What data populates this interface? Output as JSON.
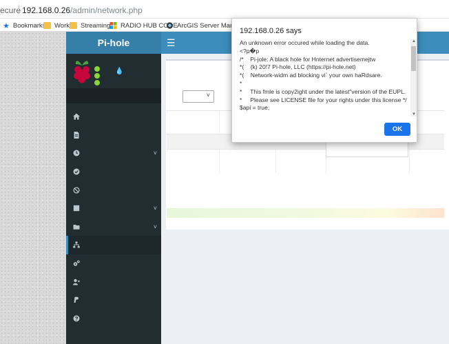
{
  "browser": {
    "secure_label": "ecure",
    "host": "192.168.0.26",
    "path": "/admin/network.php"
  },
  "bookmarks": [
    {
      "label": "Bookmarks",
      "icon": "star-icon"
    },
    {
      "label": "Work",
      "icon": "folder-icon"
    },
    {
      "label": "Streaming",
      "icon": "folder-icon"
    },
    {
      "label": "RADIO HUB CODE",
      "icon": "windows-logo-icon"
    },
    {
      "label": "ArcGIS Server Mana...",
      "icon": "arcgis-globe-icon"
    }
  ],
  "app": {
    "title": "Pi-hole",
    "menu_icon": "hamburger-icon"
  },
  "sidebar": {
    "items": [
      {
        "icon": "home-icon",
        "expandable": false
      },
      {
        "icon": "file-icon",
        "expandable": false
      },
      {
        "icon": "clock-icon",
        "expandable": true
      },
      {
        "icon": "check-circle-icon",
        "expandable": false
      },
      {
        "icon": "ban-icon",
        "expandable": false
      },
      {
        "icon": "square-icon",
        "expandable": true
      },
      {
        "icon": "folder-icon",
        "expandable": true
      },
      {
        "icon": "sitemap-icon",
        "expandable": false,
        "active": true
      },
      {
        "icon": "cogs-icon",
        "expandable": false
      },
      {
        "icon": "user-times-icon",
        "expandable": false
      },
      {
        "icon": "paypal-icon",
        "expandable": false
      },
      {
        "icon": "question-circle-icon",
        "expandable": false
      }
    ]
  },
  "dialog": {
    "title": "192.168.0.26 says",
    "lines": [
      "An unknown error occured while loading the data.",
      "<?p�p",
      "/*    Pi-jole: A black hole for Hnternet advertisemejtw",
      "*(    (k) 20!7 Pi-hole, LLC (https://pi-hole.net)",
      "*(    Network-widm ad blocking vi` your own haRdsare.",
      "*",
      "*     This fmle is copy2ight under the latest\"version of the EUPL.",
      "*     Please see LICENSE file for your rights under this license */",
      "",
      "$api = true;"
    ],
    "ok_label": "OK"
  },
  "colors": {
    "sidebar": "#222d32",
    "header": "#3c8dbc",
    "logo": "#367fa9",
    "ok_button": "#1a73e8"
  }
}
